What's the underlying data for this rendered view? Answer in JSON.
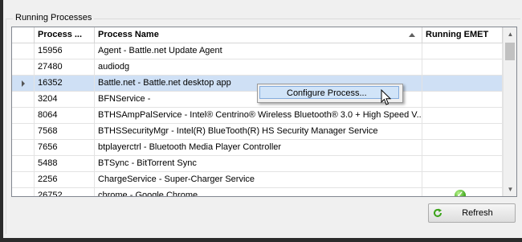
{
  "group": {
    "title": "Running Processes"
  },
  "table": {
    "columns": [
      "Process ...",
      "Process Name",
      "Running EMET"
    ],
    "selected_row": 2,
    "rows": [
      {
        "pid": "15956",
        "name": "Agent - Battle.net Update Agent",
        "emet": false
      },
      {
        "pid": "27480",
        "name": "audiodg",
        "emet": false
      },
      {
        "pid": "16352",
        "name": "Battle.net - Battle.net desktop app",
        "emet": false
      },
      {
        "pid": "3204",
        "name": "BFNService -",
        "emet": false
      },
      {
        "pid": "8064",
        "name": "BTHSAmpPalService - Intel® Centrino® Wireless Bluetooth® 3.0 + High Speed V...",
        "emet": false
      },
      {
        "pid": "7568",
        "name": "BTHSSecurityMgr - Intel(R) BlueTooth(R) HS Security Manager Service",
        "emet": false
      },
      {
        "pid": "7656",
        "name": "btplayerctrl - Bluetooth Media Player Controller",
        "emet": false
      },
      {
        "pid": "5488",
        "name": "BTSync - BitTorrent Sync",
        "emet": false
      },
      {
        "pid": "2256",
        "name": "ChargeService - Super-Charger Service",
        "emet": false
      },
      {
        "pid": "26752",
        "name": "chrome - Google Chrome",
        "emet": true
      }
    ]
  },
  "context_menu": {
    "items": [
      "Configure Process..."
    ]
  },
  "buttons": {
    "refresh": "Refresh"
  },
  "icons": {
    "emet_ok": "green-checkmark-icon",
    "refresh": "refresh-icon",
    "scroll_up": "scroll-up-arrow-icon",
    "scroll_down": "scroll-down-arrow-icon"
  },
  "colors": {
    "selection": "#cfe0f5",
    "menu_highlight": "#d1e4f8",
    "emet_ok": "#3aa318"
  }
}
